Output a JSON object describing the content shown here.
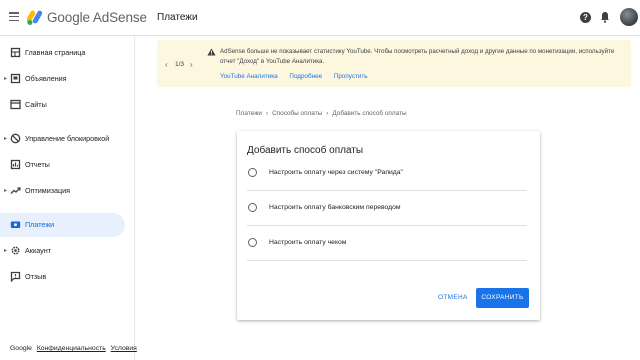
{
  "header": {
    "brand": "Google AdSense",
    "page_title": "Платежи",
    "help_icon": "?"
  },
  "sidebar": {
    "items": [
      {
        "label": "Главная страница",
        "icon": "home-icon"
      },
      {
        "label": "Объявления",
        "icon": "ads-icon",
        "expandable": true
      },
      {
        "label": "Сайты",
        "icon": "sites-icon"
      },
      {
        "label": "Управление блокировкой",
        "icon": "block-icon",
        "expandable": true
      },
      {
        "label": "Отчеты",
        "icon": "reports-icon"
      },
      {
        "label": "Оптимизация",
        "icon": "optimization-icon",
        "expandable": true
      },
      {
        "label": "Платежи",
        "icon": "payments-icon",
        "active": true
      },
      {
        "label": "Аккаунт",
        "icon": "account-icon",
        "expandable": true
      },
      {
        "label": "Отзыв",
        "icon": "feedback-icon"
      }
    ],
    "footer": {
      "google": "Google",
      "privacy": "Конфиденциальность",
      "terms": "Условия"
    }
  },
  "banner": {
    "counter": "1/3",
    "text": "AdSense больше не показывает статистику YouTube. Чтобы посмотреть расчетный доход и другие данные по монетизации, используйте отчет \"Доход\" в YouTube Аналитика.",
    "actions": [
      "YouTube Аналитика",
      "Подробнее",
      "Пропустить"
    ]
  },
  "breadcrumb": [
    "Платежи",
    "Способы оплаты",
    "Добавить способ оплаты"
  ],
  "card": {
    "title": "Добавить способ оплаты",
    "options": [
      "Настроить оплату через систему \"Рапида\"",
      "Настроить оплату банковским переводом",
      "Настроить оплату чеком"
    ],
    "cancel_label": "ОТМЕНА",
    "save_label": "СОХРАНИТЬ"
  },
  "colors": {
    "accent": "#1a73e8",
    "active_bg": "#e8f0fe",
    "banner_bg": "#fef7e0"
  }
}
